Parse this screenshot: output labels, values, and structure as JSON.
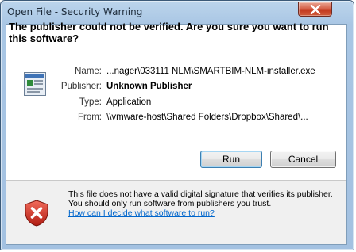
{
  "window": {
    "title": "Open File - Security Warning",
    "close_icon": "close-icon"
  },
  "heading": "The publisher could not be verified.  Are you sure you want to run this software?",
  "details": {
    "name_label": "Name:",
    "name_value": "...nager\\033111 NLM\\SMARTBIM-NLM-installer.exe",
    "publisher_label": "Publisher:",
    "publisher_value": "Unknown Publisher",
    "type_label": "Type:",
    "type_value": "Application",
    "from_label": "From:",
    "from_value": "\\\\vmware-host\\Shared Folders\\Dropbox\\Shared\\...",
    "file_icon": "application-icon"
  },
  "buttons": {
    "run": "Run",
    "cancel": "Cancel"
  },
  "footer": {
    "warning_text": "This file does not have a valid digital signature that verifies its publisher.  You should only run software from publishers you trust.",
    "help_link": "How can I decide what software to run?",
    "shield_icon": "security-shield-icon"
  },
  "colors": {
    "link": "#0066cc",
    "shield_red": "#c8261b",
    "close_red": "#c2371d",
    "frame_blue": "#a9c6e4"
  }
}
